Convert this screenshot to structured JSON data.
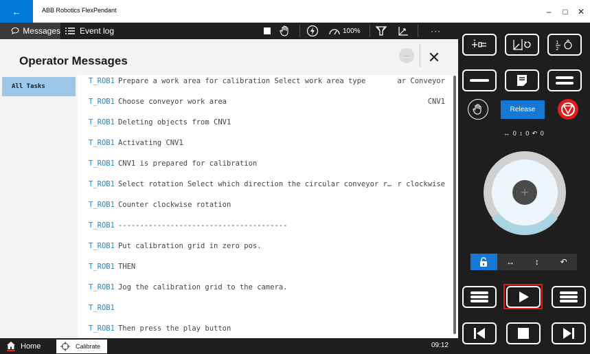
{
  "window": {
    "title": "ABB Robotics FlexPendant",
    "back_glyph": "←",
    "minimize_glyph": "–",
    "maximize_glyph": "□",
    "close_glyph": "✕"
  },
  "toolbar": {
    "messages_label": "Messages",
    "event_log_label": "Event log",
    "speed_label": "100%",
    "more_glyph": "···"
  },
  "header": {
    "title": "Operator Messages",
    "more_glyph": "···",
    "close_glyph": "✕"
  },
  "tasks": [
    {
      "label": "All Tasks",
      "selected": true
    }
  ],
  "messages": [
    {
      "source": "T_ROB1",
      "text": "Prepare a work area for calibration Select work area type",
      "right": "ar Conveyor"
    },
    {
      "source": "T_ROB1",
      "text": "Choose conveyor work area",
      "right": "CNV1"
    },
    {
      "source": "T_ROB1",
      "text": "Deleting objects from CNV1",
      "right": ""
    },
    {
      "source": "T_ROB1",
      "text": "Activating CNV1",
      "right": ""
    },
    {
      "source": "T_ROB1",
      "text": "CNV1 is prepared for calibration",
      "right": ""
    },
    {
      "source": "T_ROB1",
      "text": "Select rotation Select which direction the circular conveyor r…",
      "right": "r clockwise"
    },
    {
      "source": "T_ROB1",
      "text": "Counter clockwise rotation",
      "right": ""
    },
    {
      "source": "T_ROB1",
      "text": "---------------------------------------",
      "right": ""
    },
    {
      "source": "T_ROB1",
      "text": "Put calibration grid in zero pos.",
      "right": ""
    },
    {
      "source": "T_ROB1",
      "text": "THEN",
      "right": ""
    },
    {
      "source": "T_ROB1",
      "text": "Jog the calibration grid to the camera.",
      "right": ""
    },
    {
      "source": "T_ROB1",
      "text": "",
      "right": ""
    },
    {
      "source": "T_ROB1",
      "text": "Then press the play button",
      "right": ""
    }
  ],
  "statusbar": {
    "home_label": "Home",
    "calibrate_label": "Calibrate",
    "time": "09:12"
  },
  "panel": {
    "release_label": "Release",
    "axis_readout": "↔ 0  ↕ 0  ↶ 0",
    "jog_center_glyph": "+",
    "axis_buttons": [
      "🔓",
      "↔",
      "↕",
      "↶"
    ],
    "accent_color": "#1478d4",
    "highlight_color": "#e21c1c"
  }
}
